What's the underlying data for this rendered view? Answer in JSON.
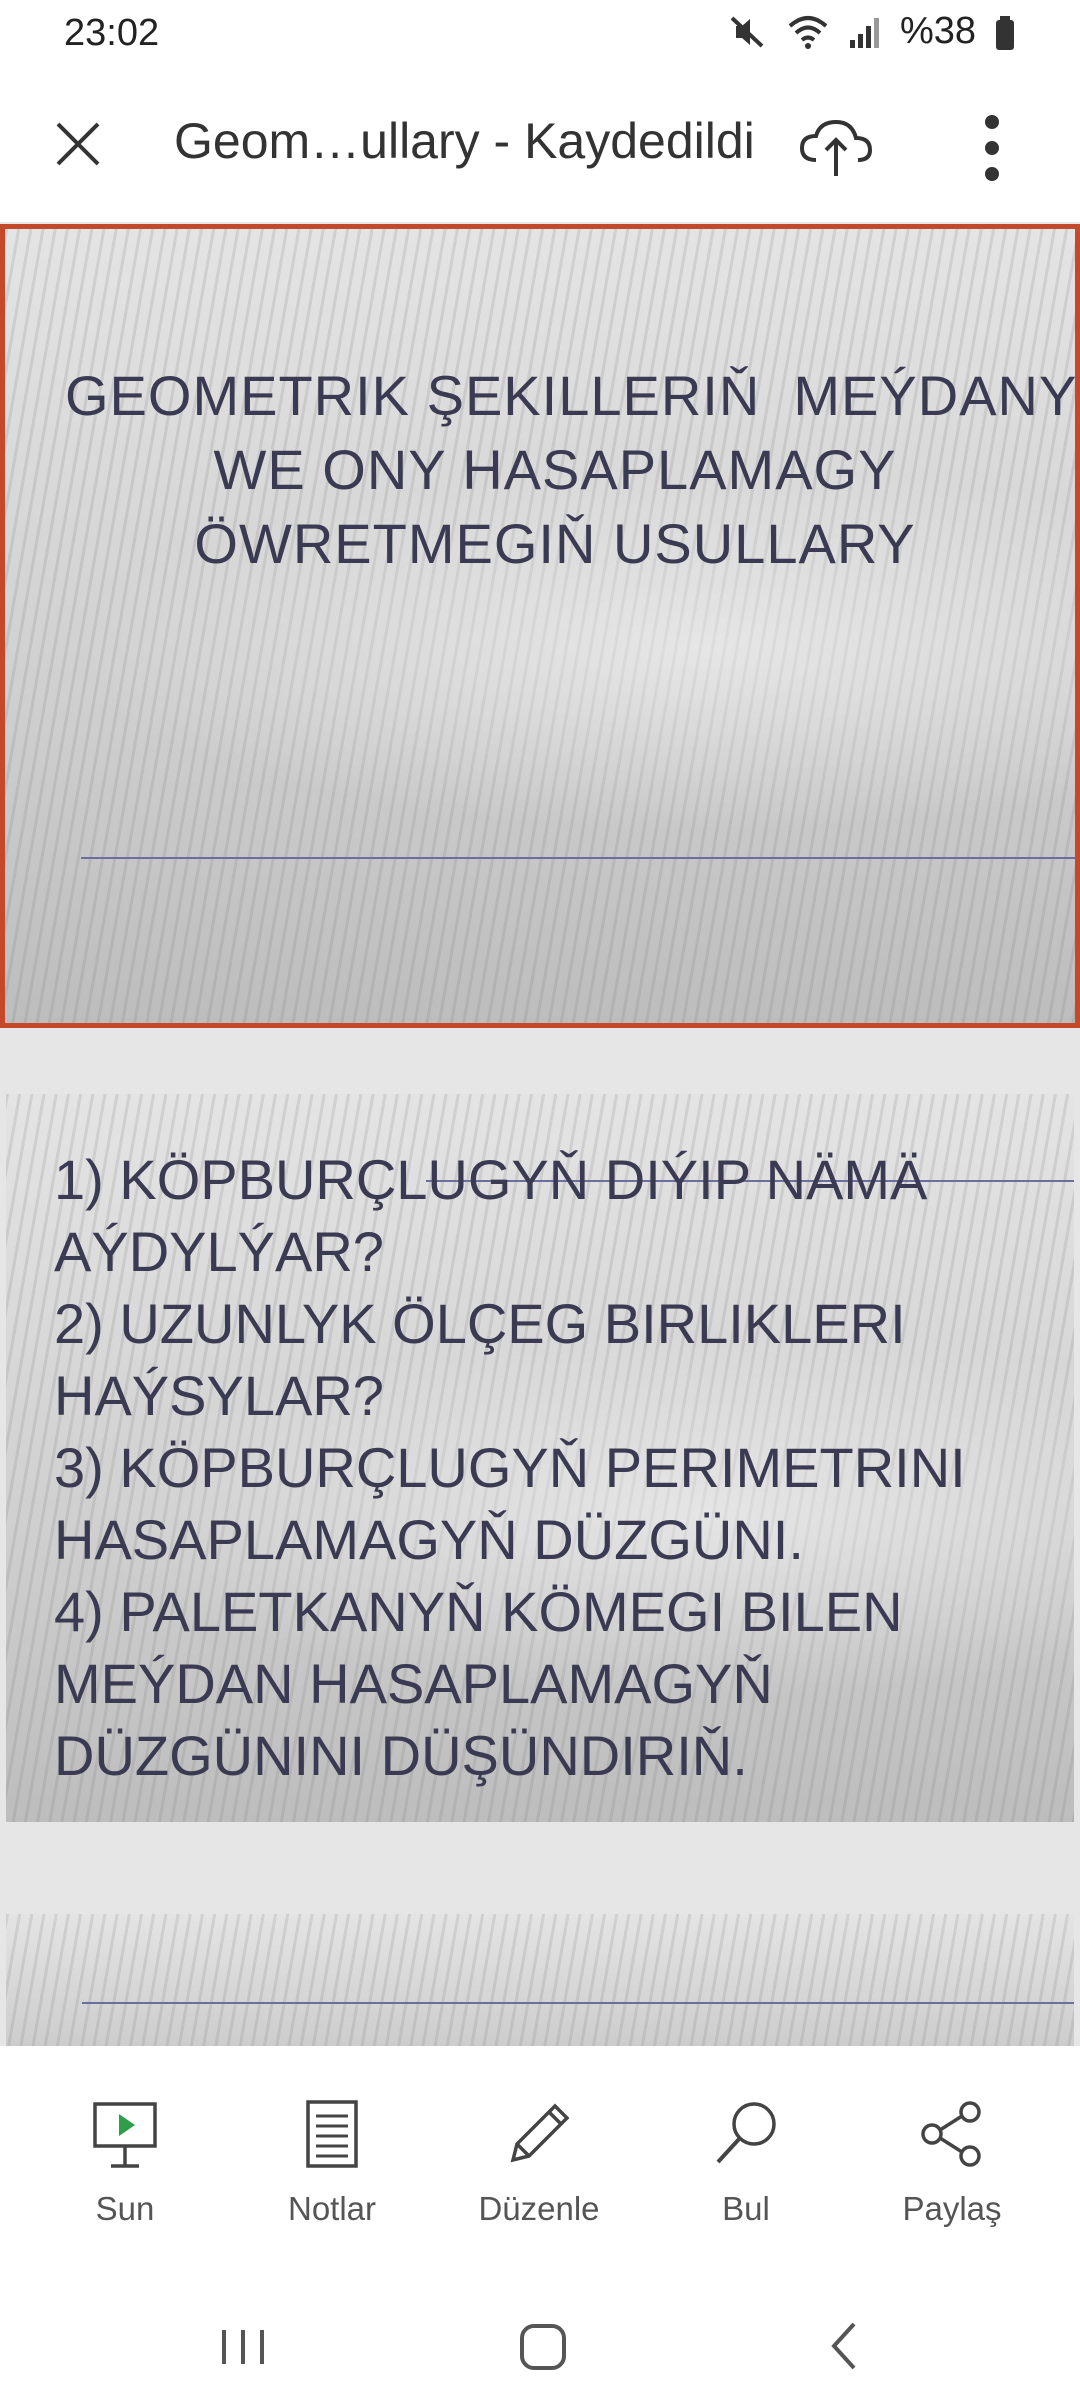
{
  "status": {
    "time": "23:02",
    "battery": "%38"
  },
  "appbar": {
    "title": "Geom…ullary - Kaydedildi"
  },
  "slides": {
    "slide1_title": [
      "GEOMETRIK ŞEKILLERIŇ  MEÝDANY",
      "WE ONY HASAPLAMAGY",
      "ÖWRETMEGIŇ USULLARY"
    ],
    "slide2_lines": [
      "1) KÖPBURÇLUGYŇ DIÝIP NÄMÄ",
      "AÝDYLÝAR?",
      "2) UZUNLYK ÖLÇEG BIRLIKLERI",
      "HAÝSYLAR?",
      "3) KÖPBURÇLUGYŇ PERIMETRINI",
      "HASAPLAMAGYŇ DÜZGÜNI.",
      "4) PALETKANYŇ KÖMEGI BILEN",
      "MEÝDAN HASAPLAMAGYŇ",
      "DÜZGÜNINI DÜŞÜNDIRIŇ."
    ]
  },
  "toolbar": {
    "sun": "Sun",
    "notlar": "Notlar",
    "duzenle": "Düzenle",
    "bul": "Bul",
    "paylas": "Paylaş"
  },
  "colors": {
    "slide_border": "#c4492b",
    "slide_text": "#3a3a52",
    "rule": "#6a6f9e"
  }
}
